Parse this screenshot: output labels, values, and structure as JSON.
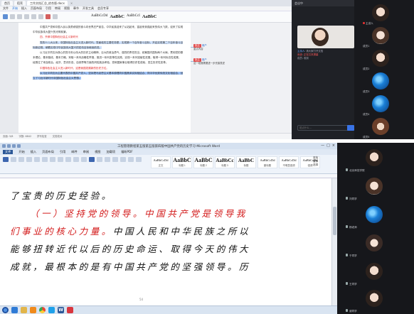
{
  "top": {
    "wps": {
      "tabs": [
        "首页",
        "稻壳",
        "工作文档汇总_综合版.docx",
        "×"
      ],
      "menu": [
        "文件",
        "开始",
        "插入",
        "页面布局",
        "引用",
        "审阅",
        "视图",
        "章节",
        "开发工具",
        "会员专享"
      ],
      "styles": [
        "AaBbCcDd",
        "AaBbC",
        "AaBbCcI",
        "AaBbC"
      ],
      "paragraphs": [
        {
          "text": "中国共产党和中国人民以英勇顽强的奋斗向世界庄严宣告，中华民族迎来了从站起来、富起来到强起来的伟大飞跃，迎来了实现中华民族伟大复兴的光明前景。",
          "style": "normal"
        },
        {
          "text": "四、开辟中国特色社会主义新时代",
          "style": "red"
        },
        {
          "text": "党的十八大以来，中国特色社会主义进入新时代。党面临的主要任务是，实现第一个百年奋斗目标，开启实现第二个百年奋斗目标新征程，朝着实现中华民族伟大复兴的宏伟目标继续前进。",
          "style": "highlight"
        },
        {
          "text": "以习近平同志为核心的党中央以伟大的历史主动精神、巨大的政治勇气、强烈的责任担当，统筹国内国际两个大局，贯彻党的基本理论、基本路线、基本方略，采取一系列战略性举措，推进一系列变革性实践，实现一系列突破性进展，取得一系列标志性成果，经受住了来自政治、经济、意识形态、自然界等方面的风险挑战考验，党和国家事业取得历史性成就、发生历史性变革。",
          "style": "normal"
        },
        {
          "text": "中国特色社会主义进入新时代，这是我国发展新的历史方位。",
          "style": "red"
        },
        {
          "text": "以习近平同志为主要代表的中国共产党人，坚持把马克思主义基本原理同中国具体实际相结合、同中华优秀传统文化相结合，创立了习近平新时代中国特色社会主义思想。",
          "style": "highlight2"
        }
      ],
      "comments": [
        {
          "badge": "批注",
          "name": "用户",
          "text": "重点内容"
        },
        {
          "badge": "批注",
          "name": "用户",
          "text": "这一段落需要进一步完善表述"
        }
      ],
      "status": [
        "页面: 5/8",
        "字数: 6842",
        "拼写检查",
        "文档校对"
      ]
    },
    "meeting_panel": {
      "header": "会议中",
      "chat": [
        {
          "name": "主持人",
          "text": "请大家打开文档",
          "color": "blue"
        },
        {
          "name": "系统",
          "text": "正在共享屏幕",
          "color": "red"
        },
        {
          "name": "成员",
          "text": "收到",
          "color": "normal"
        }
      ],
      "input_placeholder": "说点什么..."
    },
    "roster": [
      {
        "name": "主讲人",
        "avatar": "girl"
      },
      {
        "name": "成员1",
        "avatar": "girl2"
      },
      {
        "name": "成员2",
        "avatar": "girl"
      },
      {
        "name": "成员3",
        "avatar": "blue"
      },
      {
        "name": "成员4",
        "avatar": "blue"
      },
      {
        "name": "成员5",
        "avatar": "brown"
      }
    ]
  },
  "bottom": {
    "word": {
      "title": "工程管理教程第五版第五版第四版中国共产党的历史学习-Microsoft Word",
      "window_controls": [
        "—",
        "□",
        "×"
      ],
      "menu": [
        "文件",
        "开始",
        "插入",
        "页面布局",
        "引用",
        "邮件",
        "审阅",
        "视图",
        "加载项",
        "福昕PDF"
      ],
      "styles": [
        {
          "preview": "AaBbCcDd",
          "caption": "正文",
          "size": "sm"
        },
        {
          "preview": "AaBbC",
          "caption": "标题 1",
          "size": "big"
        },
        {
          "preview": "AaBbC",
          "caption": "标题 2",
          "size": "big"
        },
        {
          "preview": "AaBbCc",
          "caption": "标题 3",
          "size": "mid"
        },
        {
          "preview": "AaBbC",
          "caption": "标题",
          "size": "mid"
        },
        {
          "preview": "AaBbCcDd",
          "caption": "副标题",
          "size": "sm"
        },
        {
          "preview": "AaBbCcDd",
          "caption": "不明显强调",
          "size": "sm"
        },
        {
          "preview": "AaBbCcDd",
          "caption": "强调",
          "size": "sm"
        }
      ],
      "find_tools": [
        "查找",
        "替换",
        "选择"
      ],
      "lines": [
        {
          "text": "了宝贵的历史经验。",
          "style": "normal",
          "indent": false
        },
        {
          "text": "（一）坚持党的领导。中国共产党是领导我",
          "style": "red",
          "indent": true
        },
        {
          "text": "们事业的核心力量。中国人民和中华民族之所以",
          "style": "mixed",
          "red_part": "们事业的核心力量。",
          "rest": "中国人民和中华民族之所以",
          "indent": false
        },
        {
          "text": "能够扭转近代以后的历史命运、取得今天的伟大",
          "style": "normal",
          "indent": false
        },
        {
          "text": "成就，最根本的是有中国共产党的坚强领导。历",
          "style": "normal",
          "indent": false
        }
      ],
      "page_number": "54"
    },
    "roster": [
      {
        "name": "北京师范学院",
        "avatar": "girl"
      },
      {
        "name": "刘同学",
        "avatar": "girl2"
      },
      {
        "name": "杨老师",
        "avatar": "blue"
      },
      {
        "name": "于同学",
        "avatar": "warm"
      },
      {
        "name": "王同学",
        "avatar": "girl"
      },
      {
        "name": "谢同学",
        "avatar": "girl"
      }
    ]
  }
}
